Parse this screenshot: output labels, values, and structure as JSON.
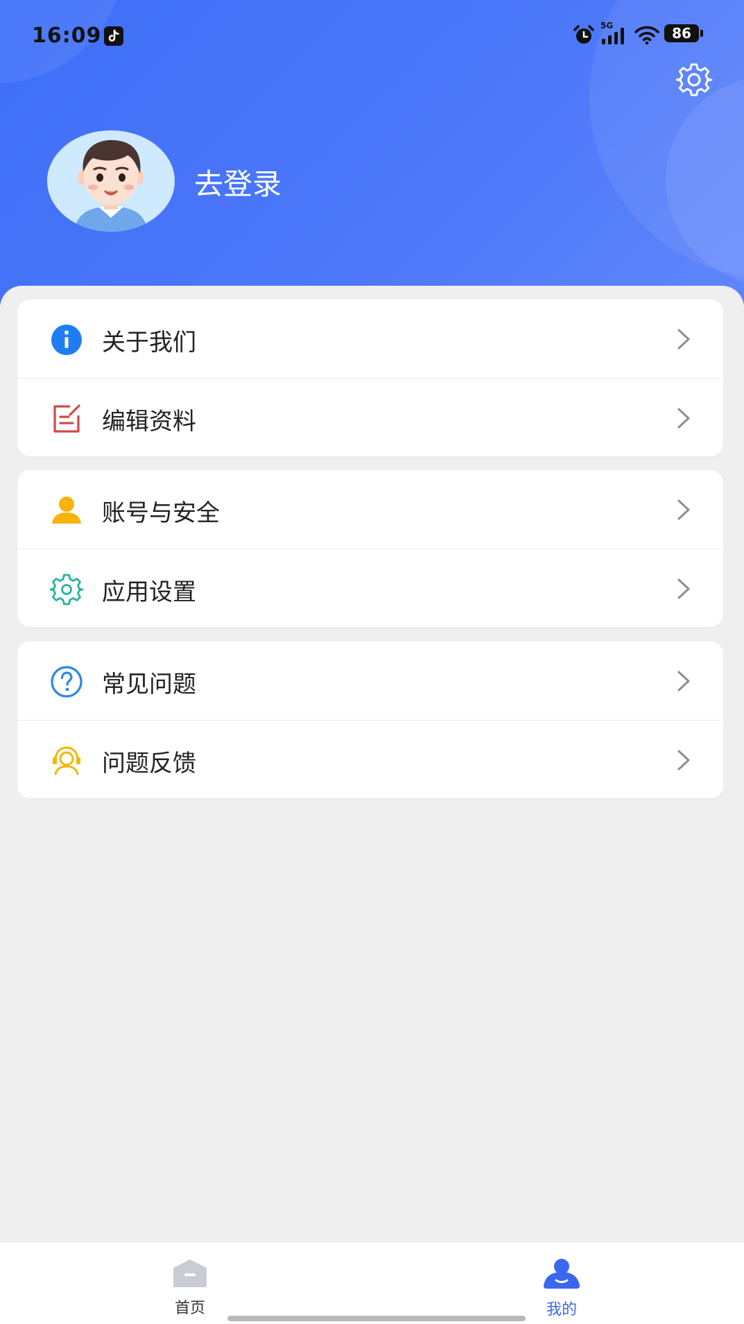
{
  "status_bar": {
    "time": "16:09",
    "battery": "86",
    "network": "5G"
  },
  "header": {
    "login_label": "去登录",
    "settings_icon": "gear-icon",
    "avatar_icon": "boy-avatar",
    "colors": {
      "gradient_start": "#3e6ff8",
      "gradient_end": "#5f86fb"
    }
  },
  "menu": {
    "group1": [
      {
        "label": "关于我们",
        "icon": "info-icon"
      },
      {
        "label": "编辑资料",
        "icon": "edit-icon"
      }
    ],
    "group2": [
      {
        "label": "账号与安全",
        "icon": "user-icon"
      },
      {
        "label": "应用设置",
        "icon": "app-settings-icon"
      }
    ],
    "group3": [
      {
        "label": "常见问题",
        "icon": "question-icon"
      },
      {
        "label": "问题反馈",
        "icon": "headset-icon"
      }
    ]
  },
  "tabbar": {
    "home_label": "首页",
    "mine_label": "我的",
    "active_color": "#3b66ee"
  }
}
